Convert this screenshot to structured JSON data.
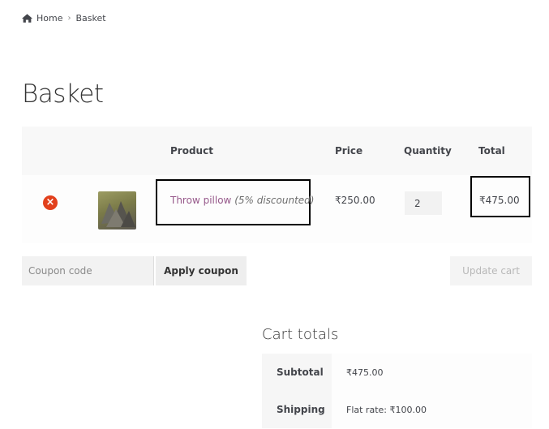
{
  "breadcrumb": {
    "home_label": "Home",
    "current_label": "Basket"
  },
  "page": {
    "title": "Basket"
  },
  "cart": {
    "columns": {
      "product": "Product",
      "price": "Price",
      "quantity": "Quantity",
      "total": "Total"
    },
    "items": [
      {
        "name": "Throw pillow",
        "discount_note": "(5% discounted)",
        "price": "₹250.00",
        "quantity": "2",
        "total": "₹475.00"
      }
    ]
  },
  "actions": {
    "coupon_placeholder": "Coupon code",
    "apply_coupon_label": "Apply coupon",
    "update_cart_label": "Update cart"
  },
  "totals": {
    "title": "Cart totals",
    "rows": [
      {
        "label": "Subtotal",
        "value": "₹475.00"
      },
      {
        "label": "Shipping",
        "value": "Flat rate: ₹100.00"
      }
    ]
  },
  "colors": {
    "accent_link": "#96588a",
    "remove_icon": "#e2401c",
    "highlight_border": "#000000"
  },
  "icons": {
    "home": "home-icon",
    "remove": "remove-item-icon"
  }
}
